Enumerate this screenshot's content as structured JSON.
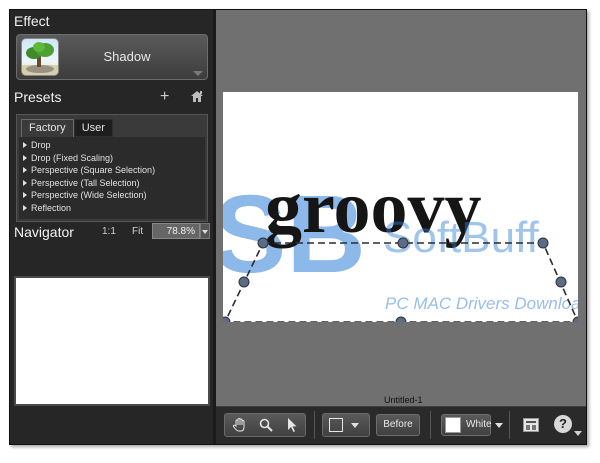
{
  "effect": {
    "section_title": "Effect",
    "selected_name": "Shadow"
  },
  "presets": {
    "section_title": "Presets",
    "add_label": "+",
    "tabs": [
      {
        "label": "Factory",
        "active": true
      },
      {
        "label": "User",
        "active": false
      }
    ],
    "items": [
      "Drop",
      "Drop (Fixed Scaling)",
      "Perspective (Square Selection)",
      "Perspective (Tall Selection)",
      "Perspective (Wide Selection)",
      "Reflection"
    ]
  },
  "navigator": {
    "section_title": "Navigator",
    "actual_size_label": "1:1",
    "fit_label": "Fit",
    "zoom_value": "78.8%"
  },
  "canvas": {
    "document_text": "groovy",
    "document_title": "Untitled-1",
    "watermark_brand": "SoftBuff",
    "watermark_tagline": "PC MAC Drivers Download"
  },
  "toolbar": {
    "before_label": "Before",
    "background_label": "White",
    "help_label": "?"
  },
  "colors": {
    "panel_bg": "#262626",
    "canvas_bg": "#707070",
    "document_bg": "#ffffff",
    "selection_handle": "#5b6c84",
    "watermark_blue": "#2f7fd9"
  }
}
